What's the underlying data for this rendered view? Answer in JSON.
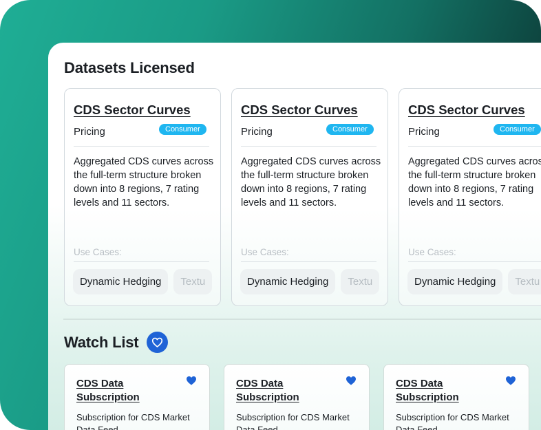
{
  "datasets": {
    "title": "Datasets Licensed",
    "cards": [
      {
        "title": "CDS Sector Curves",
        "category": "Pricing",
        "badge": "Consumer",
        "description": "Aggregated CDS curves across the full-term structure broken down into 8 regions, 7 rating levels and 11 sectors.",
        "use_cases_label": "Use Cases:",
        "tags": [
          "Dynamic Hedging",
          "Textu"
        ]
      },
      {
        "title": "CDS Sector Curves",
        "category": "Pricing",
        "badge": "Consumer",
        "description": "Aggregated CDS curves across the full-term structure broken down into 8 regions, 7 rating levels and 11 sectors.",
        "use_cases_label": "Use Cases:",
        "tags": [
          "Dynamic Hedging",
          "Textu"
        ]
      },
      {
        "title": "CDS Sector Curves",
        "category": "Pricing",
        "badge": "Consumer",
        "description": "Aggregated CDS curves across the full-term structure broken down into 8 regions, 7 rating levels and 11 sectors.",
        "use_cases_label": "Use Cases:",
        "tags": [
          "Dynamic Hedging",
          "Textu"
        ]
      }
    ]
  },
  "watchlist": {
    "title": "Watch List",
    "icon": "heart-icon",
    "cards": [
      {
        "title": "CDS Data Subscription",
        "description": "Subscription for CDS Market Data Feed",
        "icon": "heart-icon"
      },
      {
        "title": "CDS Data Subscription",
        "description": "Subscription for CDS Market Data Feed",
        "icon": "heart-icon"
      },
      {
        "title": "CDS Data Subscription",
        "description": "Subscription for CDS Market Data Feed",
        "icon": "heart-icon"
      }
    ]
  },
  "colors": {
    "accent_blue": "#1f63d6",
    "badge_blue": "#1fb6f0",
    "brand_teal": "#1fae95"
  }
}
